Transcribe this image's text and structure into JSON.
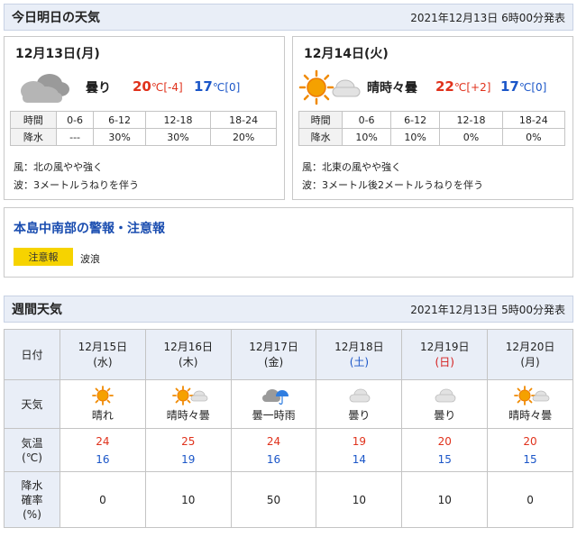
{
  "colors": {
    "header_bg": "#e9eef7",
    "hi_temp": "#e0321c",
    "lo_temp": "#1b56c8",
    "warning_badge": "#f6d300",
    "area_title": "#1a4db0"
  },
  "today_tomorrow": {
    "title": "今日明日の天気",
    "issued": "2021年12月13日 6時00分発表",
    "days": [
      {
        "date": "12月13日(月)",
        "icon": "cloudy-icon",
        "weather": "曇り",
        "high": "20",
        "high_unit": "℃",
        "high_diff": "[-4]",
        "low": "17",
        "low_unit": "℃",
        "low_diff": "[0]",
        "time_label": "時間",
        "rain_label": "降水",
        "times": [
          "0-6",
          "6-12",
          "12-18",
          "18-24"
        ],
        "rain": [
          "---",
          "30%",
          "30%",
          "20%"
        ],
        "wind": "風：北の風やや強く",
        "wave": "波：3メートルうねりを伴う"
      },
      {
        "date": "12月14日(火)",
        "icon": "sun-cloud-icon",
        "weather": "晴時々曇",
        "high": "22",
        "high_unit": "℃",
        "high_diff": "[+2]",
        "low": "17",
        "low_unit": "℃",
        "low_diff": "[0]",
        "time_label": "時間",
        "rain_label": "降水",
        "times": [
          "0-6",
          "6-12",
          "12-18",
          "18-24"
        ],
        "rain": [
          "10%",
          "10%",
          "0%",
          "0%"
        ],
        "wind": "風：北東の風やや強く",
        "wave": "波：3メートル後2メートルうねりを伴う"
      }
    ]
  },
  "warnings": {
    "title": "本島中南部の警報・注意報",
    "badge": "注意報",
    "type": "波浪"
  },
  "weekly": {
    "title": "週間天気",
    "issued": "2021年12月13日 5時00分発表",
    "row_labels": {
      "date": "日付",
      "weather": "天気",
      "temp_1": "気温",
      "temp_2": "(℃)",
      "pop_1": "降水",
      "pop_2": "確率",
      "pop_3": "(%)"
    },
    "days": [
      {
        "date": "12月15日",
        "dow": "(水)",
        "icon": "sun-icon",
        "weather": "晴れ",
        "high": "24",
        "low": "16",
        "pop": "0"
      },
      {
        "date": "12月16日",
        "dow": "(木)",
        "icon": "sun-cloud-icon",
        "weather": "晴時々曇",
        "high": "25",
        "low": "19",
        "pop": "10"
      },
      {
        "date": "12月17日",
        "dow": "(金)",
        "icon": "cloud-umbrella-icon",
        "weather": "曇一時雨",
        "high": "24",
        "low": "16",
        "pop": "50"
      },
      {
        "date": "12月18日",
        "dow": "(土)",
        "icon": "cloud-icon",
        "weather": "曇り",
        "high": "19",
        "low": "14",
        "pop": "10"
      },
      {
        "date": "12月19日",
        "dow": "(日)",
        "icon": "cloud-icon",
        "weather": "曇り",
        "high": "20",
        "low": "15",
        "pop": "10"
      },
      {
        "date": "12月20日",
        "dow": "(月)",
        "icon": "sun-cloud-icon",
        "weather": "晴時々曇",
        "high": "20",
        "low": "15",
        "pop": "0"
      }
    ]
  }
}
